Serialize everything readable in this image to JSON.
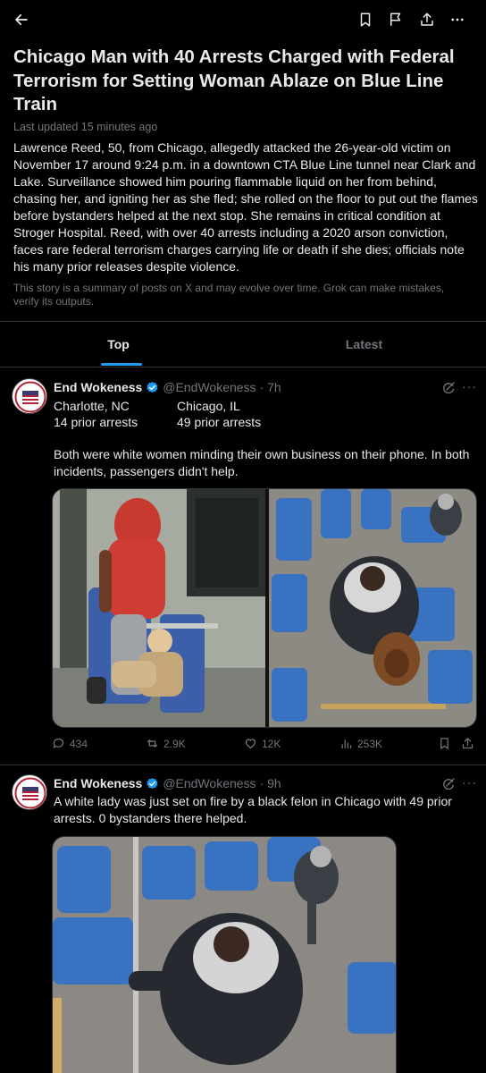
{
  "header": {
    "back_icon": "arrow-left-icon",
    "actions": [
      "bookmark-icon",
      "flag-icon",
      "share-icon",
      "more-icon"
    ]
  },
  "story": {
    "headline": "Chicago Man with 40 Arrests Charged with Federal Terrorism for Setting Woman Ablaze on Blue Line Train",
    "updated": "Last updated 15 minutes ago",
    "summary": "Lawrence Reed, 50, from Chicago, allegedly attacked the 26-year-old victim on November 17 around 9:24 p.m. in a downtown CTA Blue Line tunnel near Clark and Lake. Surveillance showed him pouring flammable liquid on her from behind, chasing her, and igniting her as she fled; she rolled on the floor to put out the flames before bystanders helped at the next stop. She remains in critical condition at Stroger Hospital. Reed, with over 40 arrests including a 2020 arson conviction, faces rare federal terrorism charges carrying life or death if she dies; officials note his many prior releases despite violence.",
    "disclaimer": "This story is a summary of posts on X and may evolve over time. Grok can make mistakes, verify its outputs."
  },
  "tabs": [
    {
      "label": "Top",
      "active": true
    },
    {
      "label": "Latest",
      "active": false
    }
  ],
  "posts": [
    {
      "name": "End Wokeness",
      "handle": "@EndWokeness",
      "time": "· 7h",
      "location_left": "Charlotte, NC",
      "arrests_left": "14 prior arrests",
      "location_right": "Chicago, IL",
      "arrests_right": "49 prior arrests",
      "text": "Both were white women minding their own business on their phone. In both incidents, passengers didn't help.",
      "stats": {
        "replies": "434",
        "reposts": "2.9K",
        "likes": "12K",
        "views": "253K"
      }
    },
    {
      "name": "End Wokeness",
      "handle": "@EndWokeness",
      "time": "· 9h",
      "text": "A white lady was just set on fire by a black felon in Chicago with 49 prior arrests. 0 bystanders there helped."
    }
  ],
  "colors": {
    "accent": "#1d9bf0",
    "background": "#000000",
    "muted": "#71767b",
    "divider": "#2f3336"
  }
}
